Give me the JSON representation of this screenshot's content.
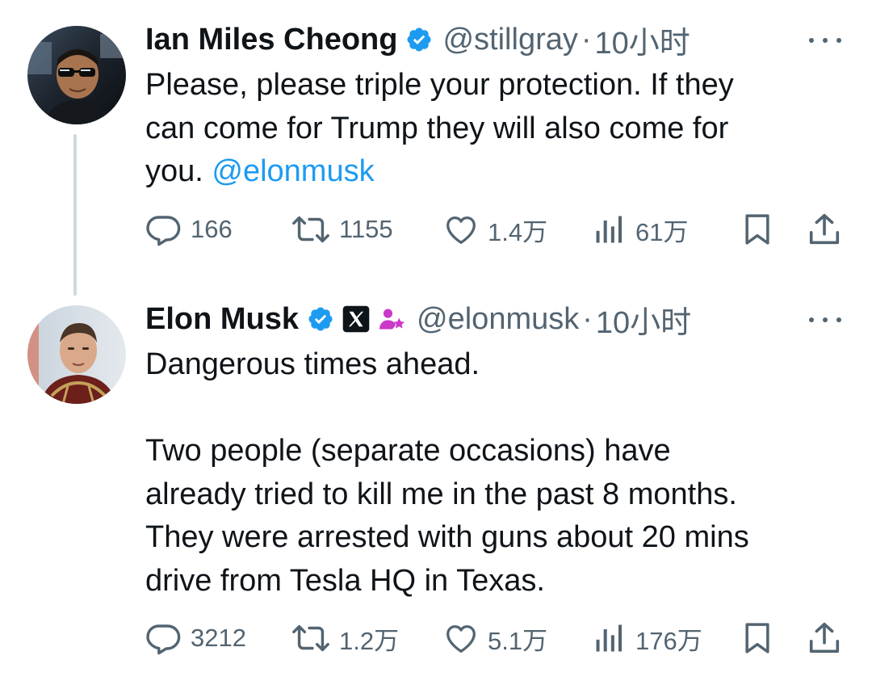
{
  "tweets": [
    {
      "display_name": "Ian Miles Cheong",
      "handle": "@stillgray",
      "separator": "·",
      "time": "10小时",
      "text_lines": [
        "Please, please triple your protection. If they",
        "can come for Trump they will also come for"
      ],
      "last_line_prefix": "you. ",
      "mention": "@elonmusk",
      "replies": "166",
      "reposts": "1155",
      "likes": "1.4万",
      "views": "61万"
    },
    {
      "display_name": "Elon Musk",
      "handle": "@elonmusk",
      "separator": "·",
      "time": "10小时",
      "paragraph1": "Dangerous times ahead.",
      "paragraph2_lines": [
        "Two people (separate occasions) have",
        "already tried to kill me in the past 8 months.",
        "They were arrested with guns about 20 mins",
        "drive from Tesla HQ in Texas."
      ],
      "replies": "3212",
      "reposts": "1.2万",
      "likes": "5.1万",
      "views": "176万"
    }
  ],
  "colors": {
    "text": "#0f1419",
    "secondary": "#536471",
    "link": "#1d9bf0",
    "verified": "#1d9bf0",
    "thread_line": "#cfd9de",
    "affiliate": "#c938c9"
  },
  "icons": [
    "verified-badge-icon",
    "x-logo-badge-icon",
    "affiliate-icon",
    "more-icon",
    "reply-icon",
    "repost-icon",
    "like-icon",
    "views-icon",
    "bookmark-icon",
    "share-icon"
  ]
}
